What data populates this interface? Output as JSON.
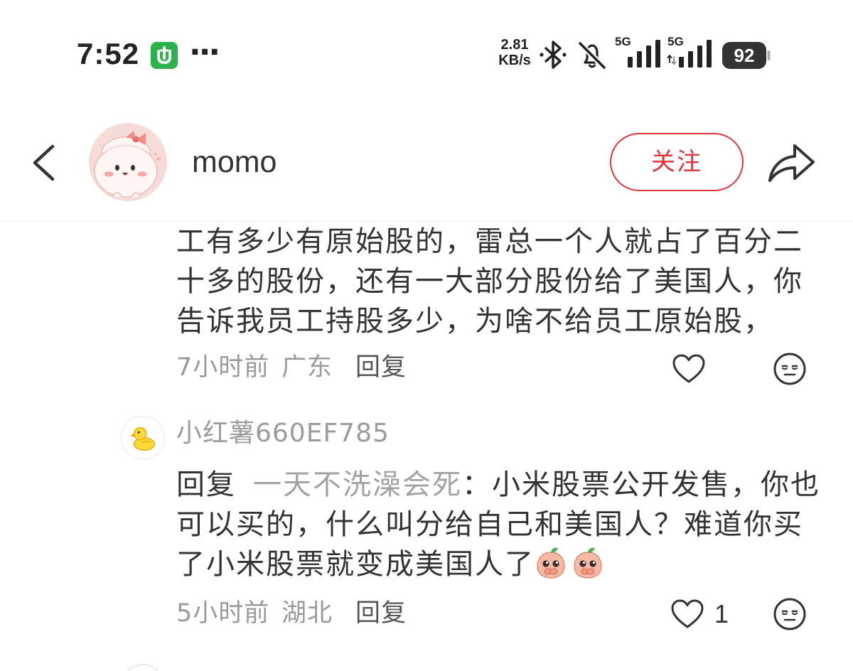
{
  "status_bar": {
    "time": "7:52",
    "app_icon": "green-app-icon",
    "more": "···",
    "net_speed": {
      "value": "2.81",
      "unit": "KB/s"
    },
    "bluetooth_icon": "bluetooth-icon",
    "silent_icon": "bell-muted-icon",
    "signal": [
      {
        "label": "5G",
        "icon": "signal-bars-icon"
      },
      {
        "label": "5G",
        "icon": "signal-bars-icon"
      }
    ],
    "battery": "92"
  },
  "header": {
    "back_icon": "chevron-left-icon",
    "avatar_icon": "cartoon-avatar",
    "username": "momo",
    "follow_label": "关注",
    "share_icon": "share-arrow-icon"
  },
  "comments": [
    {
      "text_lines": [
        "工有多少有原始股的，雷总一个人就占了百分二",
        "十多的股份，还有一大部分股份给了美国人，你",
        "告诉我员工持股多少，为啥不给员工原始股，"
      ],
      "time": "7小时前",
      "location": "广东",
      "reply_label": "回复",
      "like_icon": "heart-outline-icon",
      "dislike_icon": "neutral-face-icon"
    },
    {
      "avatar_icon": "duck-avatar",
      "username": "小红薯660EF785",
      "reply_prefix": "回复",
      "reply_to": "一天不洗澡会死",
      "text_lines": [
        "：小米股票公开发售，你也",
        "可以买的，什么叫分给自己和美国人？难道你买",
        "了小米股票就变成美国人了"
      ],
      "emojis": [
        "peach-face-emoji",
        "peach-face-emoji"
      ],
      "time": "5小时前",
      "location": "湖北",
      "reply_label": "回复",
      "like_icon": "heart-outline-icon",
      "like_count": "1",
      "dislike_icon": "neutral-face-icon"
    }
  ],
  "colors": {
    "accent": "#e0353c",
    "text": "#333333",
    "meta": "#9a9a9a",
    "reply_to": "#a3a3a3",
    "app_icon": "#2bb24c",
    "divider": "#ebebeb"
  }
}
